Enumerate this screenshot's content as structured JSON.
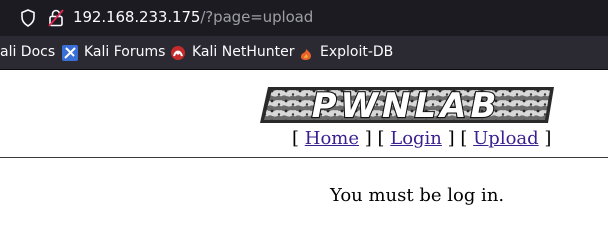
{
  "browser": {
    "url_host": "192.168.233.175",
    "url_path": "/?page=upload"
  },
  "bookmarks": [
    {
      "label": "ali Docs",
      "icon": "kali-docs-icon"
    },
    {
      "label": "Kali Forums",
      "icon": "kali-forums-icon"
    },
    {
      "label": "Kali NetHunter",
      "icon": "kali-nethunter-icon"
    },
    {
      "label": "Exploit-DB",
      "icon": "exploit-db-icon"
    }
  ],
  "page": {
    "logo_text": "PWNLAB",
    "nav": {
      "home": "Home",
      "login": "Login",
      "upload": "Upload"
    },
    "message": "You must be log in."
  },
  "colors": {
    "chrome_dark": "#1c1b22",
    "bookmarks_bar": "#2b2a33",
    "link": "#3b1f8f"
  }
}
